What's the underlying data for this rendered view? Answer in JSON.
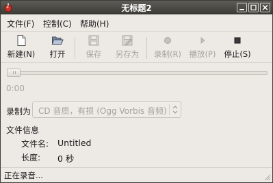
{
  "window": {
    "title": "无标题2",
    "controls": {
      "minimize": "minimize",
      "maximize": "maximize",
      "close": "close"
    }
  },
  "menubar": {
    "items": [
      {
        "label": "文件(F)"
      },
      {
        "label": "控制(C)"
      },
      {
        "label": "帮助(H)"
      }
    ]
  },
  "toolbar": {
    "new": {
      "label": "新建(N)",
      "icon": "new-document-icon",
      "enabled": true
    },
    "open": {
      "label": "打开",
      "icon": "open-folder-icon",
      "enabled": true
    },
    "save": {
      "label": "保存",
      "icon": "save-icon",
      "enabled": false
    },
    "save_as": {
      "label": "另存为",
      "icon": "save-as-icon",
      "enabled": false
    },
    "record": {
      "label": "录制(R)",
      "icon": "record-icon",
      "enabled": false
    },
    "play": {
      "label": "播放(P)",
      "icon": "play-icon",
      "enabled": false
    },
    "stop": {
      "label": "停止(S)",
      "icon": "stop-icon",
      "enabled": true
    }
  },
  "position": {
    "time": "0:00",
    "progress": 0
  },
  "record_as": {
    "label": "录制为",
    "value": "CD 音质，有损 (Ogg Vorbis 音频)"
  },
  "file_info": {
    "header": "文件信息",
    "name_label": "文件名:",
    "name_value": "Untitled",
    "length_label": "长度:",
    "length_value": "0 秒"
  },
  "status": {
    "text": "正在录音..."
  },
  "colors": {
    "titlebar": "#4a4944",
    "window_bg": "#edeae5",
    "disabled_text": "#a6a39d"
  }
}
